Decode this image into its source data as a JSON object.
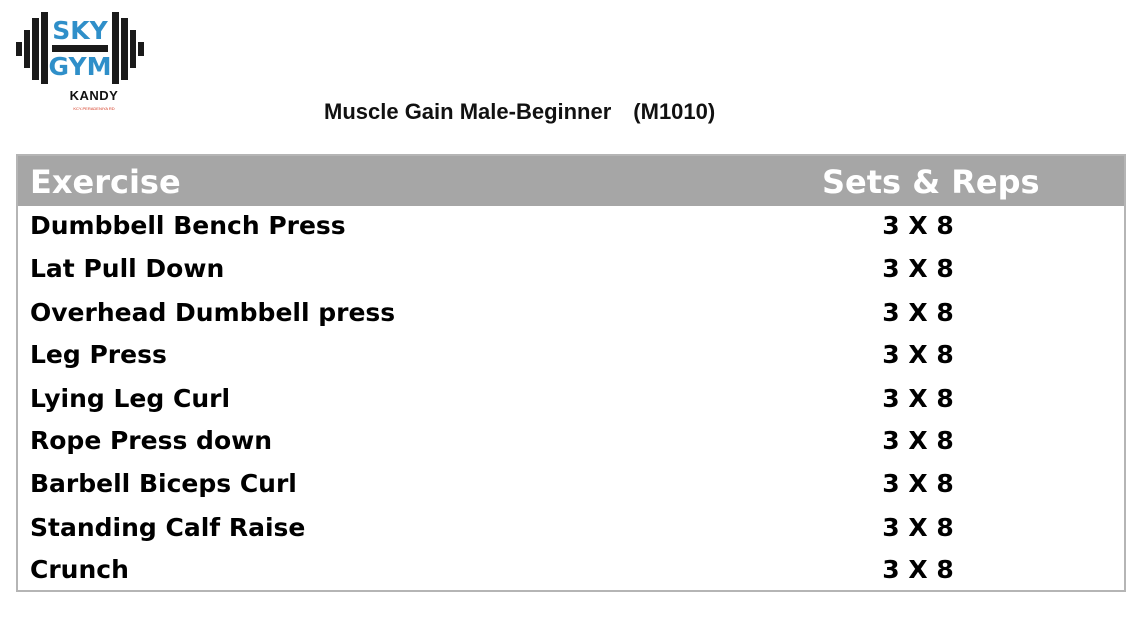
{
  "logo": {
    "line1": "SKY",
    "line2": "GYM",
    "city": "KANDY",
    "tagline": "KCY-PERADENIYA RD",
    "colors": {
      "text": "#2f8fc9",
      "barbell": "#1a1a1a"
    }
  },
  "document": {
    "title": "Muscle Gain Male-Beginner",
    "code": "(M1010)"
  },
  "table": {
    "headers": {
      "exercise": "Exercise",
      "sets_reps": "Sets & Reps"
    },
    "header_color": "#a6a6a6",
    "rows": [
      {
        "exercise": "Dumbbell Bench Press",
        "sets_reps": "3 X 8"
      },
      {
        "exercise": "Lat Pull Down",
        "sets_reps": "3 X 8"
      },
      {
        "exercise": "Overhead Dumbbell press",
        "sets_reps": "3 X 8"
      },
      {
        "exercise": "Leg Press",
        "sets_reps": "3 X 8"
      },
      {
        "exercise": "Lying Leg Curl",
        "sets_reps": "3 X 8"
      },
      {
        "exercise": "Rope Press down",
        "sets_reps": "3 X 8"
      },
      {
        "exercise": "Barbell Biceps Curl",
        "sets_reps": "3 X 8"
      },
      {
        "exercise": "Standing Calf Raise",
        "sets_reps": "3 X 8"
      },
      {
        "exercise": "Crunch",
        "sets_reps": "3 X 8"
      }
    ]
  }
}
